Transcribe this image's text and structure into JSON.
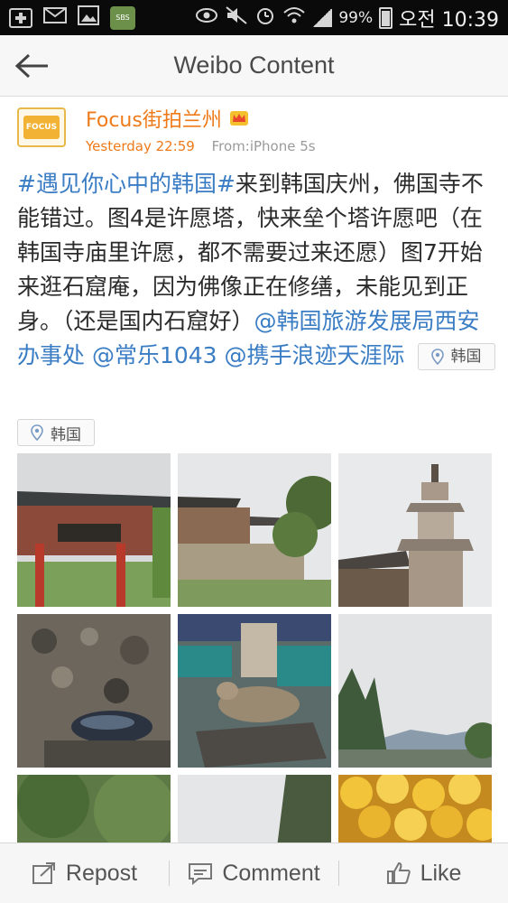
{
  "status_bar": {
    "battery": "99%",
    "time": "오전 10:39",
    "sbs_label": "SBS"
  },
  "header": {
    "title": "Weibo Content"
  },
  "post": {
    "author_name": "Focus街拍兰州",
    "avatar_text": "FOCUS",
    "time": "Yesterday 22:59",
    "source": "From:iPhone 5s",
    "hashtag": "#遇见你心中的韩国#",
    "text": "来到韩国庆州，佛国寺不能错过。图4是许愿塔，快来垒个塔许愿吧（在韩国寺庙里许愿，都不需要过来还愿）图7开始来逛石窟庵，因为佛像正在修缮，未能见到正身。（还是国内石窟好）",
    "mention_1": "@韩国旅游发展局西安办事处",
    "mention_2": "@常乐1043",
    "mention_3": "@携手浪迹天涯际",
    "location_chip_1": "韩国",
    "location_chip_2": "韩国"
  },
  "photos": [
    {
      "name": "temple-gate"
    },
    {
      "name": "temple-terrace"
    },
    {
      "name": "stone-pagoda"
    },
    {
      "name": "stone-cairns"
    },
    {
      "name": "pig-statue"
    },
    {
      "name": "mountain-view"
    },
    {
      "name": "forest"
    },
    {
      "name": "sky-tree"
    },
    {
      "name": "lanterns"
    }
  ],
  "actions": {
    "repost": "Repost",
    "comment": "Comment",
    "like": "Like"
  },
  "colors": {
    "accent_orange": "#ef7a1a",
    "link_blue": "#3b7dc4",
    "status_bar": "#0a0a0a"
  }
}
